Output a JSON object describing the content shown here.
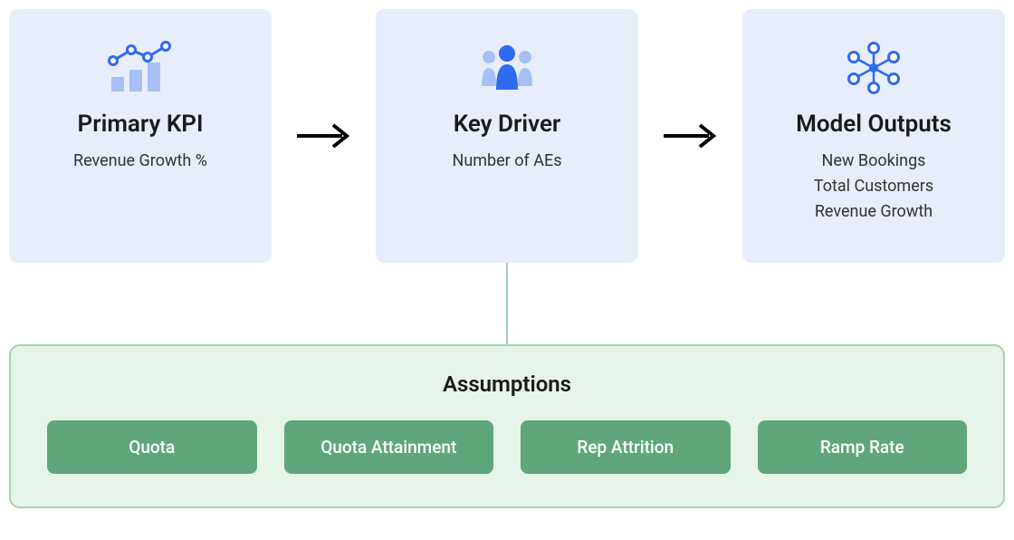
{
  "cards": {
    "primary": {
      "title": "Primary KPI",
      "sub": "Revenue Growth %"
    },
    "driver": {
      "title": "Key Driver",
      "sub": "Number of AEs"
    },
    "outputs": {
      "title": "Model Outputs",
      "line1": "New Bookings",
      "line2": "Total Customers",
      "line3": "Revenue Growth"
    }
  },
  "assumptions": {
    "title": "Assumptions",
    "items": {
      "0": "Quota",
      "1": "Quota Attainment",
      "2": "Rep Attrition",
      "3": "Ramp Rate"
    }
  },
  "colors": {
    "cardBg": "#e8edfb",
    "iconBlue": "#2e6bf0",
    "iconLight": "#a7bff5",
    "assumptionBg": "#e7f4ea",
    "assumptionBorder": "#a4d3b2",
    "pill": "#5fa77a"
  }
}
